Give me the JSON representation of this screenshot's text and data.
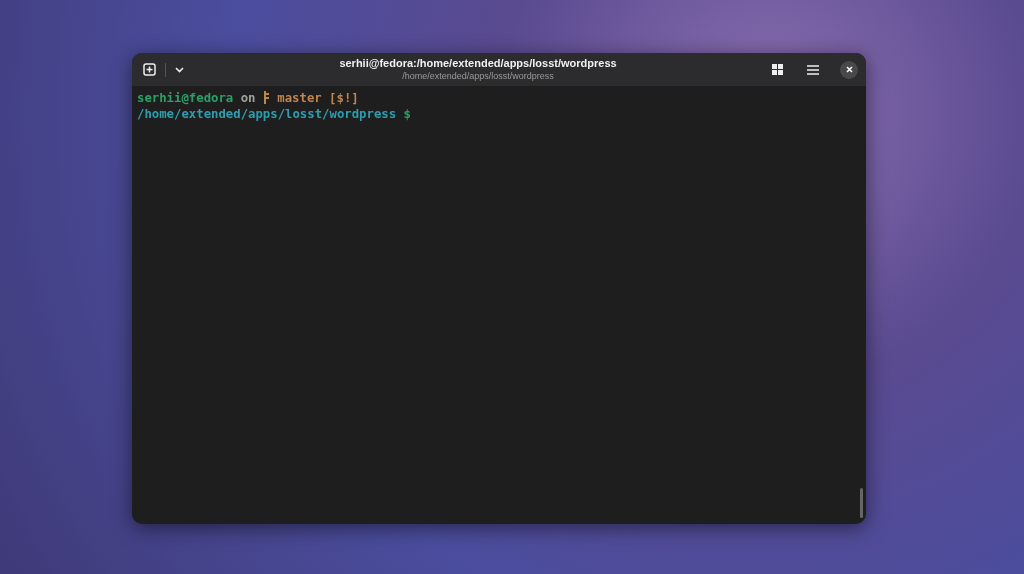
{
  "window": {
    "title": "serhii@fedora:/home/extended/apps/losst/wordpress",
    "subtitle": "/home/extended/apps/losst/wordpress"
  },
  "terminal": {
    "lines": [
      {
        "segments": [
          {
            "kind": "text",
            "text": "serhii@fedora",
            "color": "#26a269"
          },
          {
            "kind": "text",
            "text": " on ",
            "color": "#a0a0a0"
          },
          {
            "kind": "branch-icon",
            "color": "#c0844e"
          },
          {
            "kind": "text",
            "text": " master [$!]",
            "color": "#c0844e"
          }
        ]
      },
      {
        "segments": [
          {
            "kind": "text",
            "text": "/home/extended/apps/losst/wordpress",
            "color": "#2a9fb0"
          },
          {
            "kind": "text",
            "text": " $",
            "color": "#26a269"
          }
        ]
      }
    ]
  }
}
